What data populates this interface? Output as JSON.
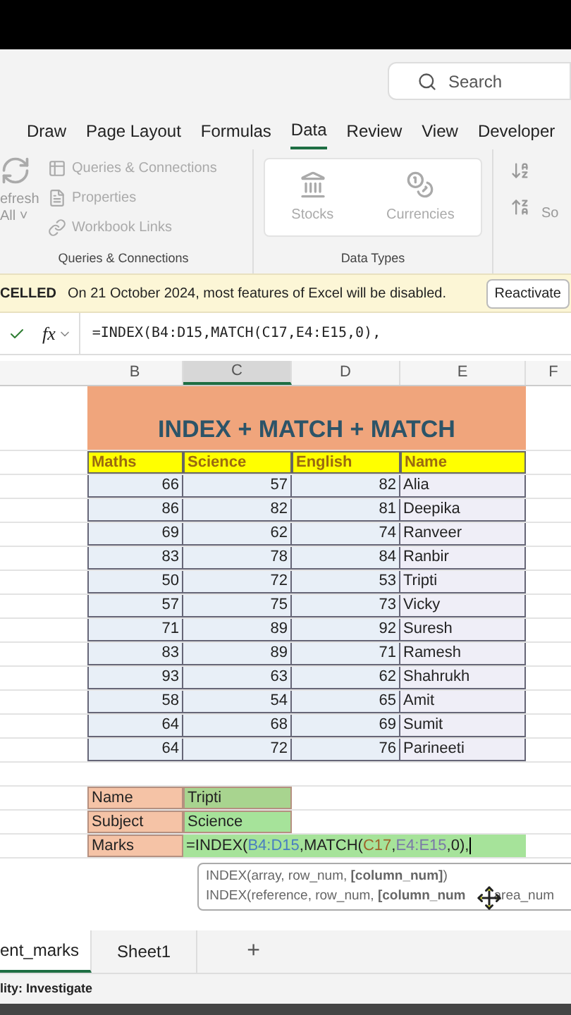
{
  "search": {
    "placeholder": "Search"
  },
  "tabs": [
    {
      "label": "Draw",
      "selected": false
    },
    {
      "label": "Page Layout",
      "selected": false
    },
    {
      "label": "Formulas",
      "selected": false
    },
    {
      "label": "Data",
      "selected": true
    },
    {
      "label": "Review",
      "selected": false
    },
    {
      "label": "View",
      "selected": false
    },
    {
      "label": "Developer",
      "selected": false
    }
  ],
  "ribbon": {
    "refresh_label": [
      "efresh",
      "All ˅"
    ],
    "queries_items": [
      "Queries & Connections",
      "Properties",
      "Workbook Links"
    ],
    "queries_group": "Queries & Connections",
    "data_types": [
      "Stocks",
      "Currencies"
    ],
    "data_types_group": "Data Types",
    "sort_label": "So"
  },
  "notice": {
    "status": "CELLED",
    "message": "On 21 October 2024, most features of Excel will be disabled.",
    "button": "Reactivate"
  },
  "formula_bar": {
    "fx": "fx",
    "formula": "=INDEX(B4:D15,MATCH(C17,E4:E15,0),"
  },
  "column_headers": [
    {
      "label": "B",
      "selected": false
    },
    {
      "label": "C",
      "selected": true
    },
    {
      "label": "D",
      "selected": false
    },
    {
      "label": "E",
      "selected": false
    },
    {
      "label": "F",
      "selected": false
    }
  ],
  "table": {
    "title": "INDEX + MATCH + MATCH",
    "columns": [
      "Maths",
      "Science",
      "English",
      "Name"
    ],
    "rows": [
      [
        "66",
        "57",
        "82",
        "Alia"
      ],
      [
        "86",
        "82",
        "81",
        "Deepika"
      ],
      [
        "69",
        "62",
        "74",
        "Ranveer"
      ],
      [
        "83",
        "78",
        "84",
        "Ranbir"
      ],
      [
        "50",
        "72",
        "53",
        "Tripti"
      ],
      [
        "57",
        "75",
        "73",
        "Vicky"
      ],
      [
        "71",
        "89",
        "92",
        "Suresh"
      ],
      [
        "83",
        "89",
        "71",
        "Ramesh"
      ],
      [
        "93",
        "63",
        "62",
        "Shahrukh"
      ],
      [
        "58",
        "54",
        "65",
        "Amit"
      ],
      [
        "64",
        "68",
        "69",
        "Sumit"
      ],
      [
        "64",
        "72",
        "76",
        "Parineeti"
      ]
    ]
  },
  "lookup": [
    {
      "label": "Name",
      "value": "Tripti"
    },
    {
      "label": "Subject",
      "value": "Science"
    }
  ],
  "marks": {
    "label": "Marks",
    "formula": [
      {
        "text": "=INDEX(",
        "kind": "plain"
      },
      {
        "text": "B4:D15",
        "kind": "range"
      },
      {
        "text": ",MATCH(",
        "kind": "plain"
      },
      {
        "text": "C17",
        "kind": "cell"
      },
      {
        "text": ",",
        "kind": "plain"
      },
      {
        "text": "E4:E15",
        "kind": "lookup"
      },
      {
        "text": ",0),",
        "kind": "plain"
      }
    ]
  },
  "tooltip": {
    "lines": [
      "INDEX(array, row_num, **[column_num]**)",
      "INDEX(reference, row_num, **[column_num**"
    ],
    "tail": "area_num"
  },
  "sheet_tabs": [
    {
      "label": "ent_marks",
      "selected": true
    },
    {
      "label": "Sheet1",
      "selected": false
    }
  ],
  "add_sheet": "+",
  "status_bar": "lity: Investigate"
}
